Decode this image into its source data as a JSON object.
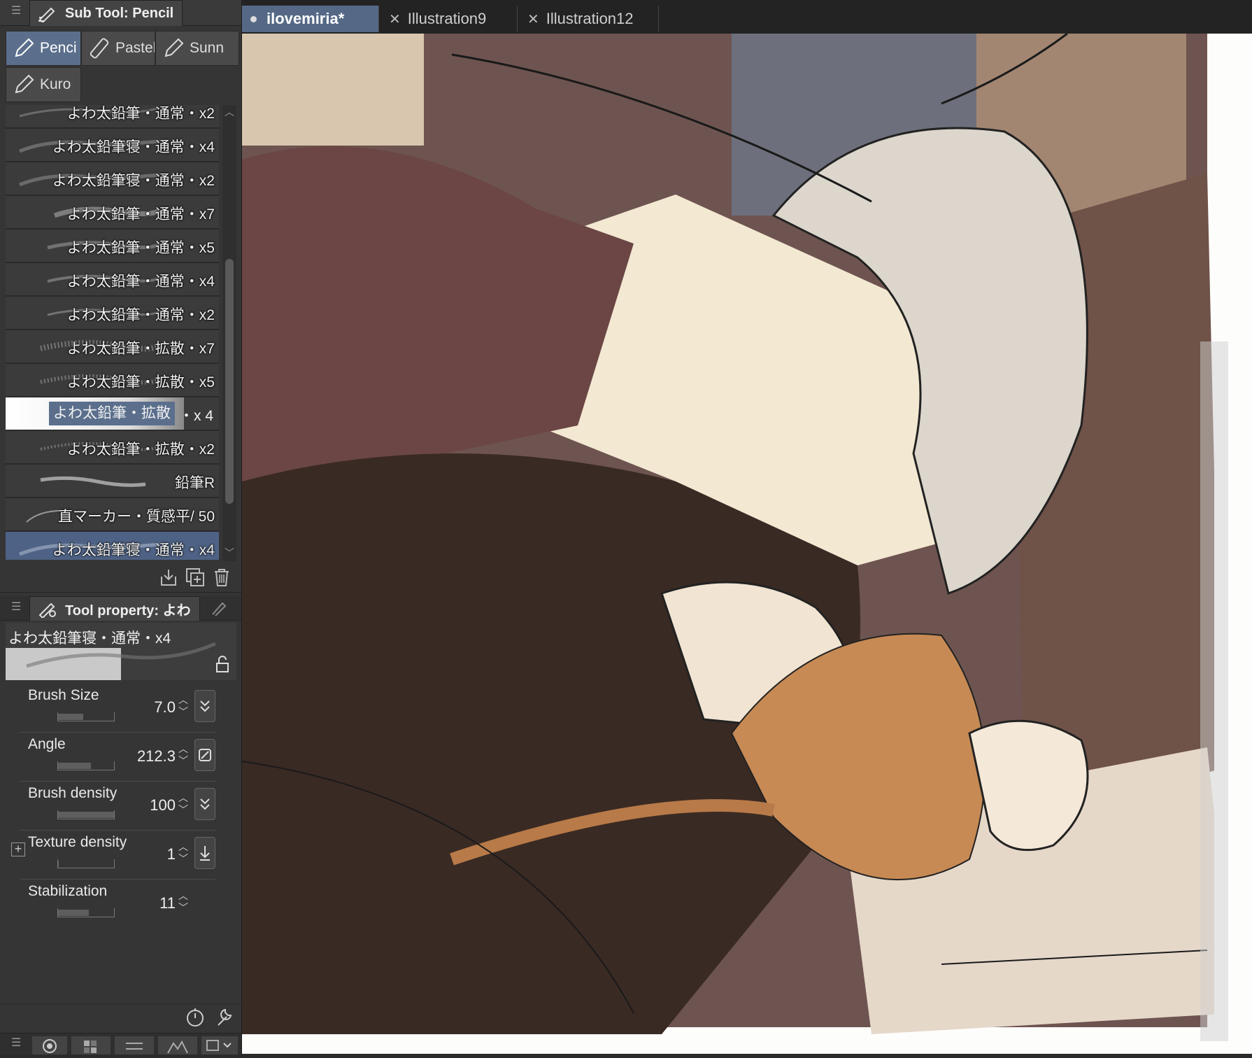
{
  "subtool_panel": {
    "title": "Sub Tool: Pencil",
    "tabs": [
      {
        "label": "Penci",
        "selected": true
      },
      {
        "label": "Pastel",
        "selected": false
      },
      {
        "label": "Sunn",
        "selected": false
      },
      {
        "label": "Kuro",
        "selected": false
      }
    ],
    "brushes": [
      {
        "label": "よわ太鉛筆・通常・x2"
      },
      {
        "label": "よわ太鉛筆寝・通常・x4"
      },
      {
        "label": "よわ太鉛筆寝・通常・x2"
      },
      {
        "label": "よわ太鉛筆・通常・x7"
      },
      {
        "label": "よわ太鉛筆・通常・x5"
      },
      {
        "label": "よわ太鉛筆・通常・x4"
      },
      {
        "label": "よわ太鉛筆・通常・x2"
      },
      {
        "label": "よわ太鉛筆・拡散・x7"
      },
      {
        "label": "よわ太鉛筆・拡散・x5"
      },
      {
        "label": "よわ太鉛筆・拡散",
        "suffix": "・x 4"
      },
      {
        "label": "よわ太鉛筆・拡散・x2"
      },
      {
        "label": "鉛筆R"
      },
      {
        "label": "直マーカー・質感平/ 50"
      },
      {
        "label": "よわ太鉛筆寝・通常・x4"
      }
    ]
  },
  "tool_property": {
    "title": "Tool property: よわ",
    "preset_name": "よわ太鉛筆寝・通常・x4",
    "props": [
      {
        "name": "Brush Size",
        "value": "7.0",
        "fill": 0.45
      },
      {
        "name": "Angle",
        "value": "212.3",
        "fill": 0.59
      },
      {
        "name": "Brush density",
        "value": "100",
        "fill": 1.0
      },
      {
        "name": "Texture density",
        "value": "1",
        "fill": 0.01
      },
      {
        "name": "Stabilization",
        "value": "11",
        "fill": 0.55
      }
    ]
  },
  "document_tabs": [
    {
      "label": "ilovemiria*",
      "active": true
    },
    {
      "label": "Illustration9",
      "active": false
    },
    {
      "label": "Illustration12",
      "active": false
    }
  ],
  "colors": {
    "accent": "#5b6f8d",
    "panel": "#353535",
    "canvas_bg": "#fdfdfc"
  }
}
